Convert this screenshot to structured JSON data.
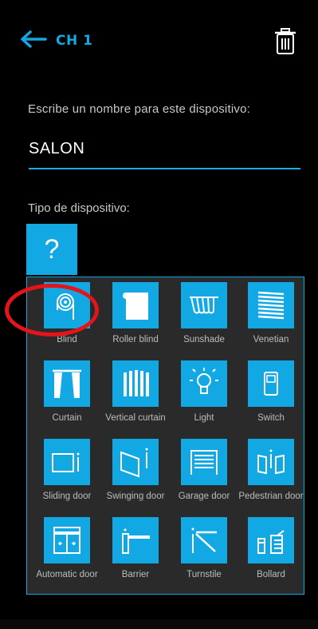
{
  "header": {
    "title": "CH 1",
    "back_icon": "arrow-left-icon",
    "delete_icon": "trash-icon"
  },
  "name_field": {
    "label": "Escribe un nombre para este dispositivo:",
    "value": "SALON"
  },
  "type_field": {
    "label": "Tipo de dispositivo:",
    "selected_symbol": "?"
  },
  "device_types": [
    {
      "label": "Blind",
      "icon": "blind-icon"
    },
    {
      "label": "Roller blind",
      "icon": "roller-blind-icon"
    },
    {
      "label": "Sunshade",
      "icon": "sunshade-icon"
    },
    {
      "label": "Venetian",
      "icon": "venetian-icon"
    },
    {
      "label": "Curtain",
      "icon": "curtain-icon"
    },
    {
      "label": "Vertical curtain",
      "icon": "vertical-curtain-icon"
    },
    {
      "label": "Light",
      "icon": "light-icon"
    },
    {
      "label": "Switch",
      "icon": "switch-icon"
    },
    {
      "label": "Sliding door",
      "icon": "sliding-door-icon"
    },
    {
      "label": "Swinging door",
      "icon": "swinging-door-icon"
    },
    {
      "label": "Garage door",
      "icon": "garage-door-icon"
    },
    {
      "label": "Pedestrian door",
      "icon": "pedestrian-door-icon"
    },
    {
      "label": "Automatic door",
      "icon": "automatic-door-icon"
    },
    {
      "label": "Barrier",
      "icon": "barrier-icon"
    },
    {
      "label": "Turnstile",
      "icon": "turnstile-icon"
    },
    {
      "label": "Bollard",
      "icon": "bollard-icon"
    }
  ],
  "colors": {
    "accent": "#12a8e3",
    "background": "#000000",
    "panel": "#2a2a2a",
    "highlight": "#e5141b"
  }
}
